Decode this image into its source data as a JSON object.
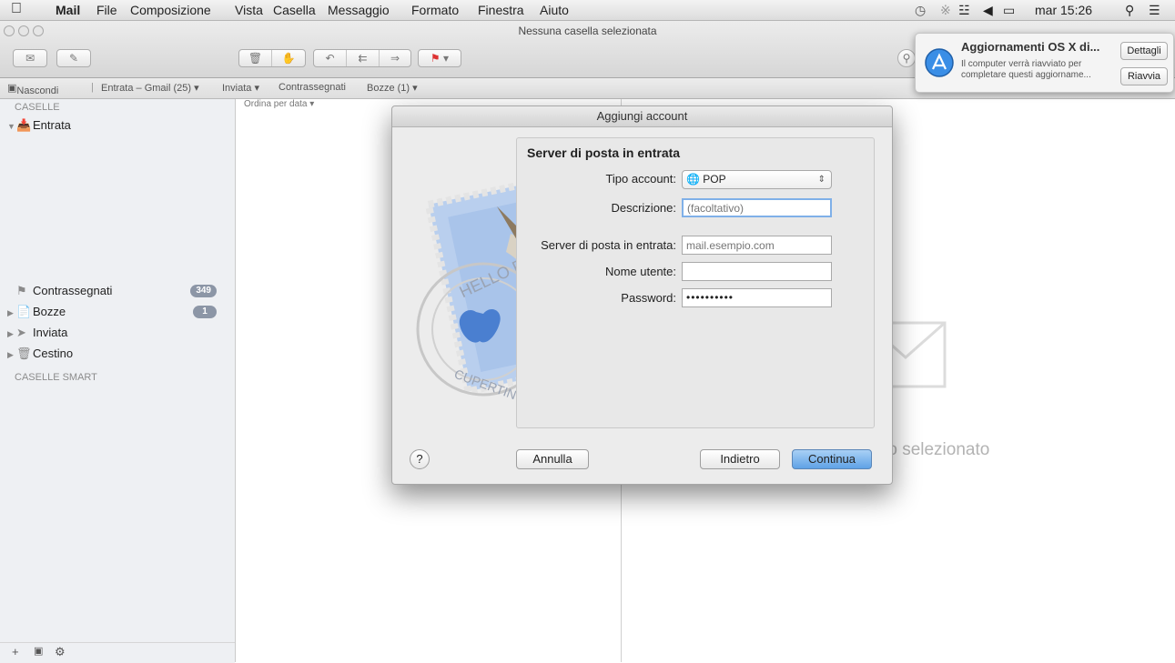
{
  "menubar": {
    "app_name": "Mail",
    "items": [
      "File",
      "Composizione",
      "Vista",
      "Casella",
      "Messaggio",
      "Formato",
      "Finestra",
      "Aiuto"
    ],
    "clock": "mar 15:26"
  },
  "window": {
    "title": "Nessuna casella selezionata"
  },
  "favorites_bar": {
    "hide": "Nascondi",
    "inbox": "Entrata – Gmail (25) ▾",
    "sent": "Inviata ▾",
    "flagged": "Contrassegnati",
    "drafts": "Bozze (1) ▾"
  },
  "sidebar": {
    "header_mailboxes": "CASELLE",
    "inbox": "Entrata",
    "flagged": "Contrassegnati",
    "flagged_count": "349",
    "drafts": "Bozze",
    "drafts_count": "1",
    "sent": "Inviata",
    "trash": "Cestino",
    "header_smart": "CASELLE SMART"
  },
  "list": {
    "sort_label": "Ordina per data ▾"
  },
  "viewer": {
    "empty_text": "ggio selezionato"
  },
  "notification": {
    "title": "Aggiornamenti OS X di...",
    "body": "Il computer verrà riavviato per completare questi aggiorname...",
    "details_button": "Dettagli",
    "restart_button": "Riavvia"
  },
  "dialog": {
    "title": "Aggiungi account",
    "section_title": "Server di posta in entrata",
    "account_type_label": "Tipo account:",
    "account_type_value": "POP",
    "description_label": "Descrizione:",
    "description_placeholder": "(facoltativo)",
    "incoming_server_label": "Server di posta in entrata:",
    "incoming_server_placeholder": "mail.esempio.com",
    "username_label": "Nome utente:",
    "password_label": "Password:",
    "password_value": "••••••••••",
    "cancel_button": "Annulla",
    "back_button": "Indietro",
    "continue_button": "Continua",
    "help": "?"
  },
  "stamp": {
    "text_top": "HELLO FR",
    "text_bottom": "CUPERTINO"
  },
  "colors": {
    "accent": "#5fa2e6",
    "badge": "#8c96a6"
  }
}
